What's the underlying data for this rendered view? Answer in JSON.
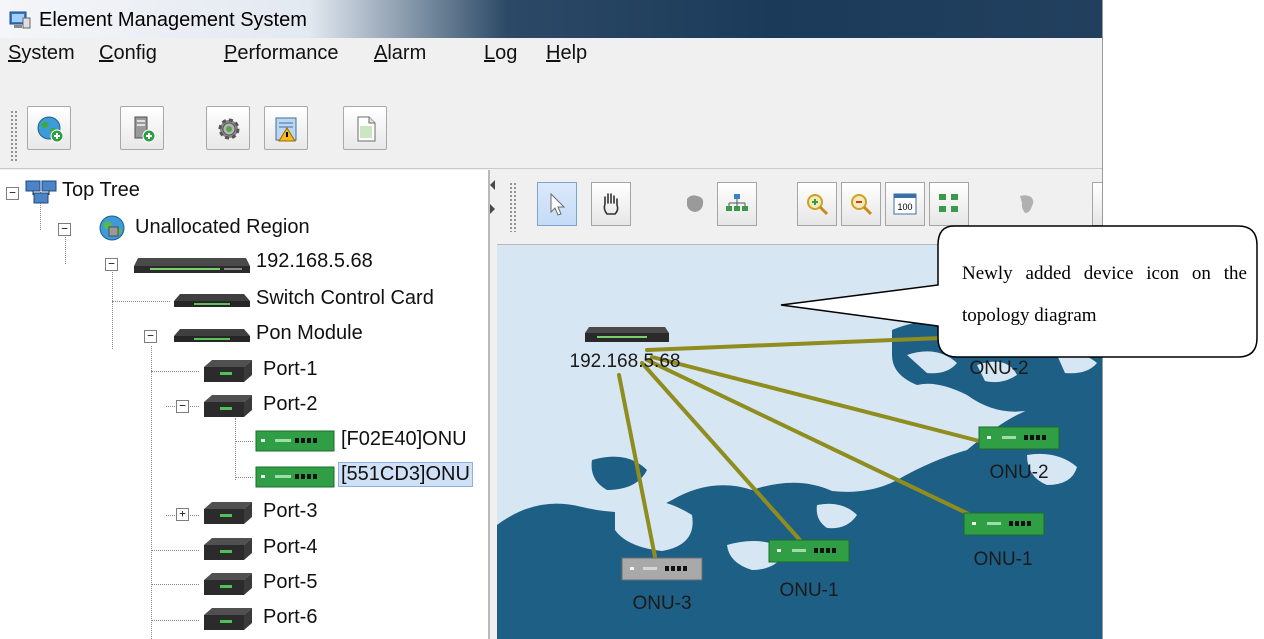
{
  "window": {
    "title": "Element Management System"
  },
  "menu": [
    {
      "mnemonic": "S",
      "rest": "ystem"
    },
    {
      "mnemonic": "C",
      "rest": "onfig"
    },
    {
      "mnemonic": "P",
      "rest": "erformance"
    },
    {
      "mnemonic": "A",
      "rest": "larm"
    },
    {
      "mnemonic": "L",
      "rest": "og"
    },
    {
      "mnemonic": "H",
      "rest": "elp"
    }
  ],
  "toolbar_icons": [
    "globe-add-icon",
    "server-add-icon",
    "gear-icon",
    "alarm-report-icon",
    "document-icon"
  ],
  "tree": {
    "root": "Top Tree",
    "region": "Unallocated Region",
    "device": "192.168.5.68",
    "switch_card": "Switch Control Card",
    "pon_module": "Pon Module",
    "ports": [
      "Port-1",
      "Port-2",
      "Port-3",
      "Port-4",
      "Port-5",
      "Port-6"
    ],
    "onus": [
      "[F02E40]ONU",
      "[551CD3]ONU"
    ]
  },
  "topology": {
    "tools": [
      "select-arrow-icon",
      "pan-hand-icon",
      "map-icon",
      "hierarchy-layout-icon",
      "zoom-in-icon",
      "zoom-out-icon",
      "zoom-100-icon",
      "grid-layout-icon",
      "map-outline-icon"
    ],
    "zoom_button_text": "100",
    "nodes": {
      "olt": "192.168.5.68",
      "onu_top": "ONU-2",
      "onu_right": "ONU-2",
      "onu_lower_right": "ONU-1",
      "onu_middle": "ONU-1",
      "onu_left": "ONU-3"
    }
  },
  "callout": {
    "text": "Newly added device icon on the topology diagram"
  },
  "colors": {
    "link": "#8f8d1e",
    "sea": "#1e5f86",
    "land": "#d6e6f3",
    "onu_green": "#2e9e45"
  }
}
